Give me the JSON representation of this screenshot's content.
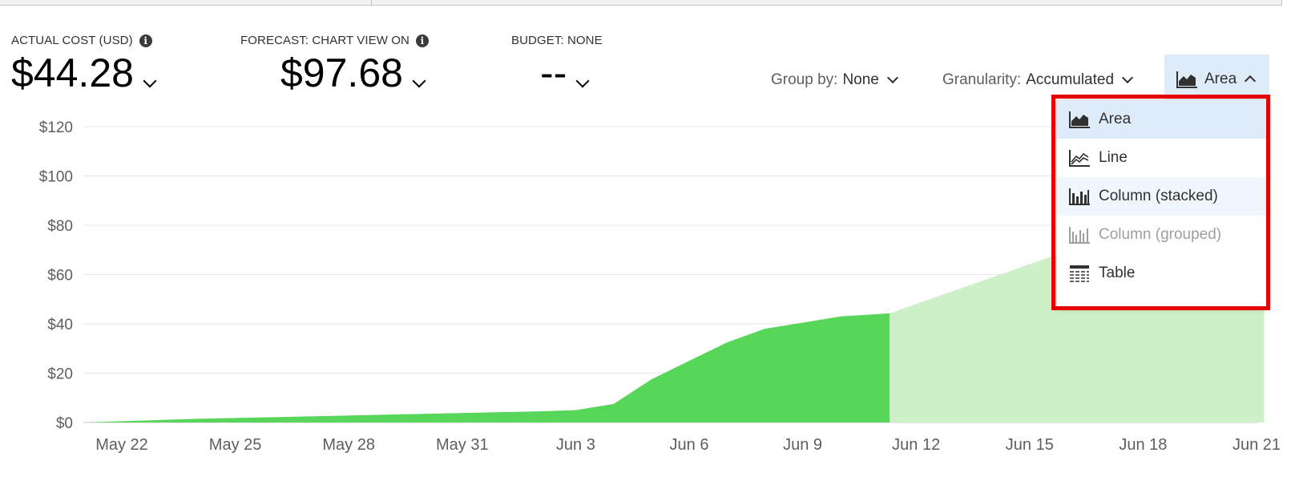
{
  "kpis": [
    {
      "label": "ACTUAL COST (USD)",
      "value": "$44.28",
      "has_info": true
    },
    {
      "label": "FORECAST: CHART VIEW ON",
      "value": "$97.68",
      "has_info": true
    },
    {
      "label": "BUDGET: NONE",
      "value": "--",
      "has_info": false
    }
  ],
  "toolbar": {
    "group_by_label": "Group by:",
    "group_by_value": "None",
    "granularity_label": "Granularity:",
    "granularity_value": "Accumulated",
    "view_value": "Area"
  },
  "view_menu": {
    "items": [
      {
        "label": "Area",
        "icon": "area-chart-icon",
        "state": "selected"
      },
      {
        "label": "Line",
        "icon": "line-chart-icon",
        "state": "normal"
      },
      {
        "label": "Column (stacked)",
        "icon": "column-stacked-icon",
        "state": "hovered"
      },
      {
        "label": "Column (grouped)",
        "icon": "column-grouped-icon",
        "state": "disabled"
      },
      {
        "label": "Table",
        "icon": "table-icon",
        "state": "normal"
      }
    ]
  },
  "colors": {
    "actual": "#57d65a",
    "forecast": "#cdf0c8",
    "selected_bg": "#deecf9",
    "highlight": "#e60000"
  },
  "chart_data": {
    "type": "area",
    "ylim": [
      0,
      120
    ],
    "y_ticks": [
      "$0",
      "$20",
      "$40",
      "$60",
      "$80",
      "$100",
      "$120"
    ],
    "y_tick_values": [
      0,
      20,
      40,
      60,
      80,
      100,
      120
    ],
    "x_tick_labels": [
      "May 22",
      "May 25",
      "May 28",
      "May 31",
      "Jun 3",
      "Jun 6",
      "Jun 9",
      "Jun 12",
      "Jun 15",
      "Jun 18",
      "Jun 21"
    ],
    "x_tick_days": [
      0,
      3,
      6,
      9,
      12,
      15,
      18,
      21,
      24,
      27,
      30
    ],
    "series": [
      {
        "values": [
          [
            -1,
            0
          ],
          [
            2,
            1.5
          ],
          [
            5,
            2.5
          ],
          [
            8,
            3.5
          ],
          [
            11,
            4.5
          ],
          [
            12,
            5
          ],
          [
            13,
            7.5
          ],
          [
            14,
            17.5
          ],
          [
            15,
            25
          ],
          [
            16,
            32.5
          ],
          [
            17,
            38
          ],
          [
            18,
            40.5
          ],
          [
            19,
            43
          ],
          [
            20.3,
            44.28
          ]
        ]
      },
      {
        "values": [
          [
            20.3,
            44.28
          ],
          [
            30.2,
            97.68
          ]
        ]
      }
    ]
  }
}
